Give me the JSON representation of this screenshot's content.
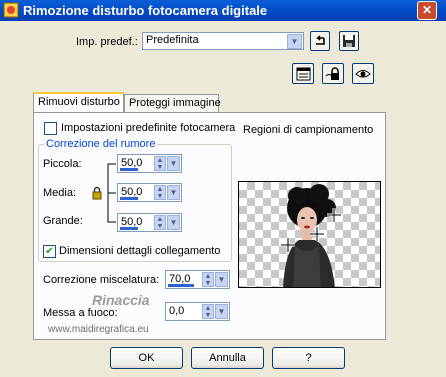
{
  "window": {
    "title": "Rimozione disturbo fotocamera digitale",
    "close_glyph": "✕"
  },
  "preset": {
    "label": "Imp. predef.:",
    "value": "Predefinita"
  },
  "tabs": [
    {
      "label": "Rimuovi disturbo"
    },
    {
      "label": "Proteggi immagine"
    }
  ],
  "options": {
    "default_settings_label": "Impostazioni predefinite fotocamera"
  },
  "noise_group": {
    "legend": "Correzione del rumore",
    "small": {
      "label": "Piccola:",
      "value": "50,0"
    },
    "medium": {
      "label": "Media:",
      "value": "50,0"
    },
    "large": {
      "label": "Grande:",
      "value": "50,0"
    }
  },
  "link_details": {
    "label": "Dimensioni dettagli collegamento",
    "checked": true
  },
  "blend": {
    "label": "Correzione miscelatura:",
    "value": "70,0"
  },
  "sharpen": {
    "label": "Messa a fuoco:",
    "value": "0,0"
  },
  "sampling": {
    "label": "Regioni di campionamento"
  },
  "watermark": {
    "line1": "Rinaccia",
    "line2": "www.maidiregrafica.eu"
  },
  "buttons": {
    "ok": "OK",
    "cancel": "Annulla",
    "help": "?"
  },
  "colors": {
    "title_bar": "#0a5fd8",
    "accent": "#0046d5",
    "face": "#ece9d8"
  }
}
